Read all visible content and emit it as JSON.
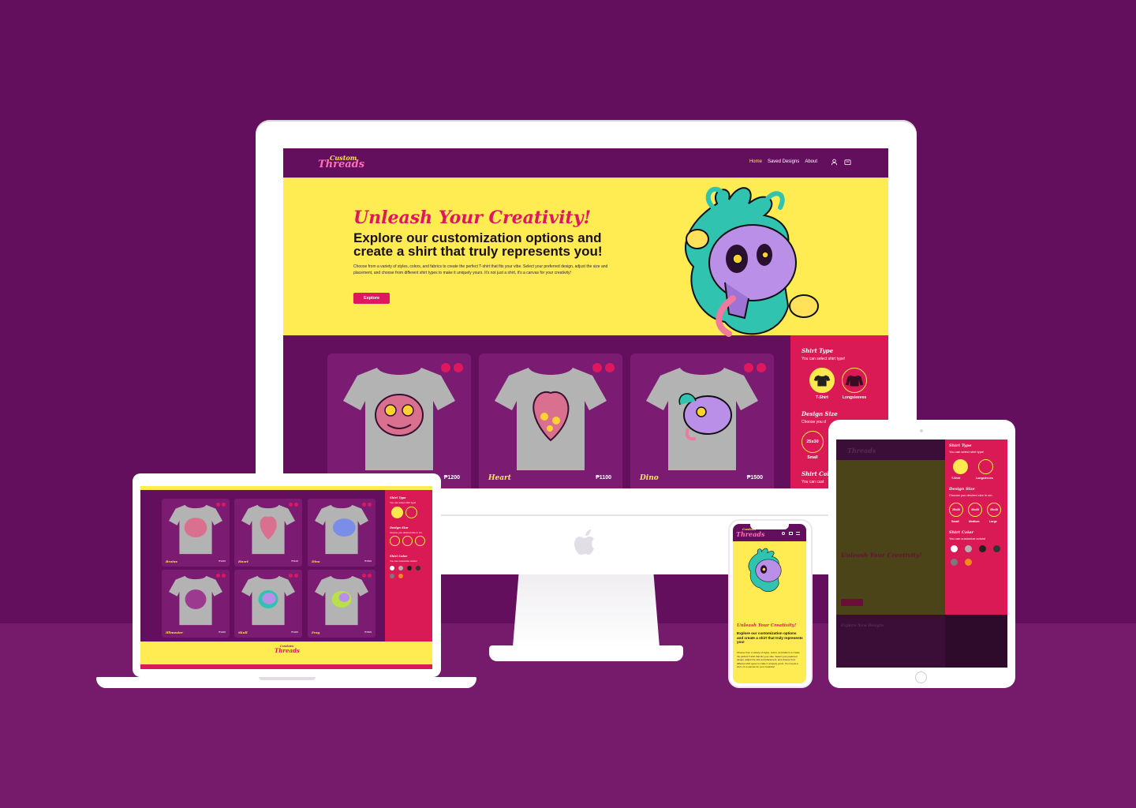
{
  "site": {
    "logo_top": "Custom",
    "logo_bottom": "Threads",
    "nav": {
      "home": "Home",
      "saved": "Saved Designs",
      "about": "About"
    }
  },
  "hero": {
    "tagline": "Unleash Your Creativity!",
    "title": "Explore our customization options and create a shirt that truly represents you!",
    "body": "Choose from a variety of styles, colors, and fabrics to create the perfect T-shirt that fits your vibe. Select your preferred design, adjust the size and placement, and choose from different shirt types to make it uniquely yours. It's not just a shirt, it's a canvas for your creativity!",
    "cta": "Explore"
  },
  "products": [
    {
      "name": "Brains",
      "price": "₱1200"
    },
    {
      "name": "Heart",
      "price": "₱1100"
    },
    {
      "name": "Dino",
      "price": "₱1500"
    },
    {
      "name": "Illimester",
      "price": "₱1200"
    },
    {
      "name": "Skull",
      "price": "₱1200"
    },
    {
      "name": "Frog",
      "price": "₱1500"
    }
  ],
  "desktop_products": [
    {
      "name": "",
      "price": "₱1200"
    },
    {
      "name": "Heart",
      "price": "₱1100"
    },
    {
      "name": "Dino",
      "price": "₱1500"
    }
  ],
  "filters": {
    "shirt_type": {
      "title": "Shirt Type",
      "hint": "You can select shirt type!",
      "options": [
        "T-Shirt",
        "Longsleeves"
      ]
    },
    "design_size": {
      "title": "Design Size",
      "hint": "Choose you desired size in cm.",
      "hint_cut": "Choose you d",
      "options": [
        "25x30",
        "30x35",
        "35x40"
      ],
      "labels": [
        "Small",
        "Medium",
        "Large"
      ]
    },
    "shirt_color": {
      "title": "Shirt Color",
      "hint": "You can customize colors!",
      "hint_cut": "You can cust"
    }
  },
  "laptop_footer": {
    "logo_top": "Custom",
    "logo_bottom": "Threads"
  },
  "tablet": {
    "explore_title": "Explore New Designs"
  },
  "colors": {
    "page_bg": "#640f5e",
    "yellow": "#ffeb52",
    "pink": "#da1a55",
    "card": "#7b1c72",
    "swatches": [
      "#ffffff",
      "#b0b0b0",
      "#222222",
      "#333333",
      "#7a7a7a",
      "#f08a1a"
    ]
  },
  "icons": [
    "apple-icon",
    "user-icon",
    "cart-icon",
    "bookmark-icon",
    "save-icon",
    "t-shirt-icon",
    "longsleeve-icon",
    "menu-icon"
  ]
}
